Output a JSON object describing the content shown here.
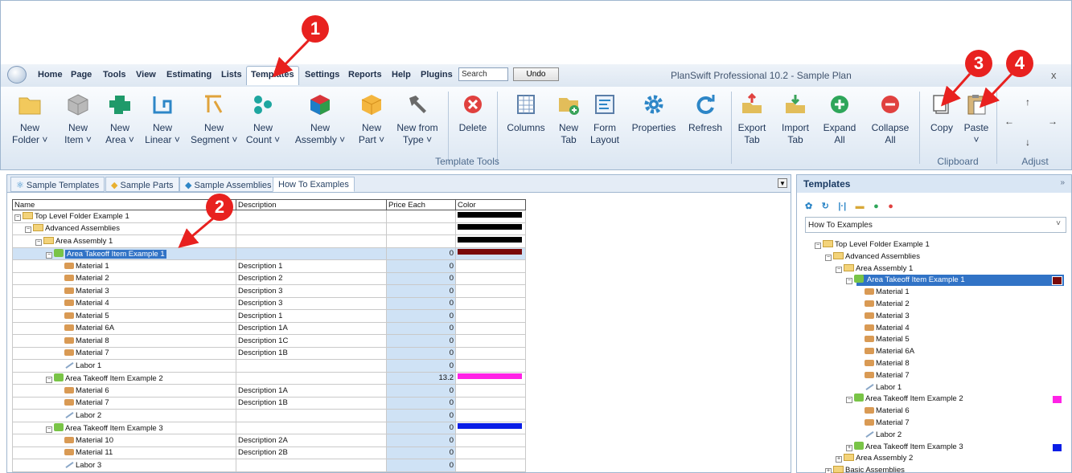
{
  "app": {
    "title": "PlanSwift Professional 10.2 - Sample Plan"
  },
  "menu": [
    "Home",
    "Page",
    "Tools",
    "View",
    "Estimating",
    "Lists",
    "Templates",
    "Settings",
    "Reports",
    "Help",
    "Plugins"
  ],
  "menu_active": "Templates",
  "search": {
    "value": "Search"
  },
  "undo_label": "Undo",
  "close_label": "x",
  "ribbon": {
    "buttons": [
      {
        "l1": "New",
        "l2": "Folder ˅"
      },
      {
        "l1": "New",
        "l2": "Item ˅"
      },
      {
        "l1": "New",
        "l2": "Area ˅"
      },
      {
        "l1": "New",
        "l2": "Linear ˅"
      },
      {
        "l1": "New",
        "l2": "Segment ˅"
      },
      {
        "l1": "New",
        "l2": "Count ˅"
      },
      {
        "l1": "New",
        "l2": "Assembly ˅"
      },
      {
        "l1": "New",
        "l2": "Part ˅"
      },
      {
        "l1": "New from",
        "l2": "Type ˅"
      },
      {
        "l1": "Delete",
        "l2": ""
      },
      {
        "l1": "Columns",
        "l2": ""
      },
      {
        "l1": "New",
        "l2": "Tab"
      },
      {
        "l1": "Form",
        "l2": "Layout"
      },
      {
        "l1": "Properties",
        "l2": ""
      },
      {
        "l1": "Refresh",
        "l2": ""
      },
      {
        "l1": "Export",
        "l2": "Tab"
      },
      {
        "l1": "Import",
        "l2": "Tab"
      },
      {
        "l1": "Expand",
        "l2": "All"
      },
      {
        "l1": "Collapse",
        "l2": "All"
      },
      {
        "l1": "Copy",
        "l2": ""
      },
      {
        "l1": "Paste",
        "l2": "˅"
      }
    ],
    "groups": {
      "template_tools": "Template Tools",
      "clipboard": "Clipboard",
      "adjust": "Adjust"
    },
    "adjust_arrows": {
      "up": "↑",
      "left": "←",
      "right": "→",
      "down": "↓"
    }
  },
  "tabs": [
    "Sample Templates",
    "Sample Parts",
    "Sample Assemblies",
    "How To Examples"
  ],
  "grid": {
    "headers": [
      "Name",
      "Description",
      "Price Each",
      "Color"
    ],
    "rows": [
      {
        "name": "Top Level Folder Example 1",
        "desc": "",
        "price": "",
        "color": "#000000",
        "icon": "folder",
        "indent": 0,
        "pm": "−"
      },
      {
        "name": "Advanced Assemblies",
        "desc": "",
        "price": "",
        "color": "#000000",
        "icon": "folder",
        "indent": 1,
        "pm": "−"
      },
      {
        "name": "Area Assembly 1",
        "desc": "",
        "price": "",
        "color": "#000000",
        "icon": "folder",
        "indent": 2,
        "pm": "−"
      },
      {
        "name": "Area Takeoff Item Example 1",
        "desc": "",
        "price": "0",
        "color": "#7a0a0a",
        "icon": "area",
        "indent": 3,
        "pm": "−",
        "selected": true
      },
      {
        "name": "Material 1",
        "desc": "Description 1",
        "price": "0",
        "color": "",
        "icon": "mat",
        "indent": 4
      },
      {
        "name": "Material 2",
        "desc": "Description 2",
        "price": "0",
        "color": "",
        "icon": "mat",
        "indent": 4
      },
      {
        "name": "Material 3",
        "desc": "Description 3",
        "price": "0",
        "color": "",
        "icon": "mat",
        "indent": 4
      },
      {
        "name": "Material 4",
        "desc": "Description 3",
        "price": "0",
        "color": "",
        "icon": "mat",
        "indent": 4
      },
      {
        "name": "Material 5",
        "desc": "Description 1",
        "price": "0",
        "color": "",
        "icon": "mat",
        "indent": 4
      },
      {
        "name": "Material 6A",
        "desc": "Description 1A",
        "price": "0",
        "color": "",
        "icon": "mat",
        "indent": 4
      },
      {
        "name": "Material 8",
        "desc": "Description 1C",
        "price": "0",
        "color": "",
        "icon": "mat",
        "indent": 4
      },
      {
        "name": "Material 7",
        "desc": "Description 1B",
        "price": "0",
        "color": "",
        "icon": "mat",
        "indent": 4
      },
      {
        "name": "Labor 1",
        "desc": "",
        "price": "0",
        "color": "",
        "icon": "lab",
        "indent": 4
      },
      {
        "name": "Area Takeoff Item Example 2",
        "desc": "",
        "price": "13.2",
        "color": "#ff22e6",
        "icon": "area",
        "indent": 3,
        "pm": "−"
      },
      {
        "name": "Material 6",
        "desc": "Description 1A",
        "price": "0",
        "color": "",
        "icon": "mat",
        "indent": 4
      },
      {
        "name": "Material 7",
        "desc": "Description 1B",
        "price": "0",
        "color": "",
        "icon": "mat",
        "indent": 4
      },
      {
        "name": "Labor 2",
        "desc": "",
        "price": "0",
        "color": "",
        "icon": "lab",
        "indent": 4
      },
      {
        "name": "Area Takeoff Item Example 3",
        "desc": "",
        "price": "0",
        "color": "#0a1ee6",
        "icon": "area",
        "indent": 3,
        "pm": "−"
      },
      {
        "name": "Material 10",
        "desc": "Description 2A",
        "price": "0",
        "color": "",
        "icon": "mat",
        "indent": 4
      },
      {
        "name": "Material 11",
        "desc": "Description 2B",
        "price": "0",
        "color": "",
        "icon": "mat",
        "indent": 4
      },
      {
        "name": "Labor 3",
        "desc": "",
        "price": "0",
        "color": "",
        "icon": "lab",
        "indent": 4
      }
    ]
  },
  "templates_panel": {
    "title": "Templates",
    "chevron": "»",
    "tool_icons": [
      "gear-icon",
      "refresh-icon",
      "bar-icon",
      "folder-new-icon",
      "add-icon",
      "remove-icon"
    ],
    "dropdown_value": "How To Examples",
    "tree": [
      {
        "name": "Top Level Folder Example 1",
        "icon": "folder",
        "indent": 0,
        "pm": "−"
      },
      {
        "name": "Advanced Assemblies",
        "icon": "folder",
        "indent": 1,
        "pm": "−"
      },
      {
        "name": "Area Assembly 1",
        "icon": "folder",
        "indent": 2,
        "pm": "−"
      },
      {
        "name": "Area Takeoff Item Example 1",
        "icon": "area",
        "indent": 3,
        "pm": "−",
        "selected": true,
        "color": "#7a0a0a"
      },
      {
        "name": "Material 1",
        "icon": "mat",
        "indent": 4
      },
      {
        "name": "Material 2",
        "icon": "mat",
        "indent": 4
      },
      {
        "name": "Material 3",
        "icon": "mat",
        "indent": 4
      },
      {
        "name": "Material 4",
        "icon": "mat",
        "indent": 4
      },
      {
        "name": "Material 5",
        "icon": "mat",
        "indent": 4
      },
      {
        "name": "Material 6A",
        "icon": "mat",
        "indent": 4
      },
      {
        "name": "Material 8",
        "icon": "mat",
        "indent": 4
      },
      {
        "name": "Material 7",
        "icon": "mat",
        "indent": 4
      },
      {
        "name": "Labor 1",
        "icon": "lab",
        "indent": 4
      },
      {
        "name": "Area Takeoff Item Example 2",
        "icon": "area",
        "indent": 3,
        "pm": "−",
        "color": "#ff22e6"
      },
      {
        "name": "Material 6",
        "icon": "mat",
        "indent": 4
      },
      {
        "name": "Material 7",
        "icon": "mat",
        "indent": 4
      },
      {
        "name": "Labor 2",
        "icon": "lab",
        "indent": 4
      },
      {
        "name": "Area Takeoff Item Example 3",
        "icon": "area",
        "indent": 3,
        "pm": "+",
        "color": "#0a1ee6"
      },
      {
        "name": "Area Assembly 2",
        "icon": "folder",
        "indent": 2,
        "pm": "+"
      },
      {
        "name": "Basic Assemblies",
        "icon": "folder",
        "indent": 1,
        "pm": "+"
      }
    ]
  },
  "callouts": [
    "1",
    "2",
    "3",
    "4"
  ],
  "colors": {
    "accent": "#3173c6",
    "callout": "#e8211f",
    "price_bg": "#cfe2f5"
  }
}
